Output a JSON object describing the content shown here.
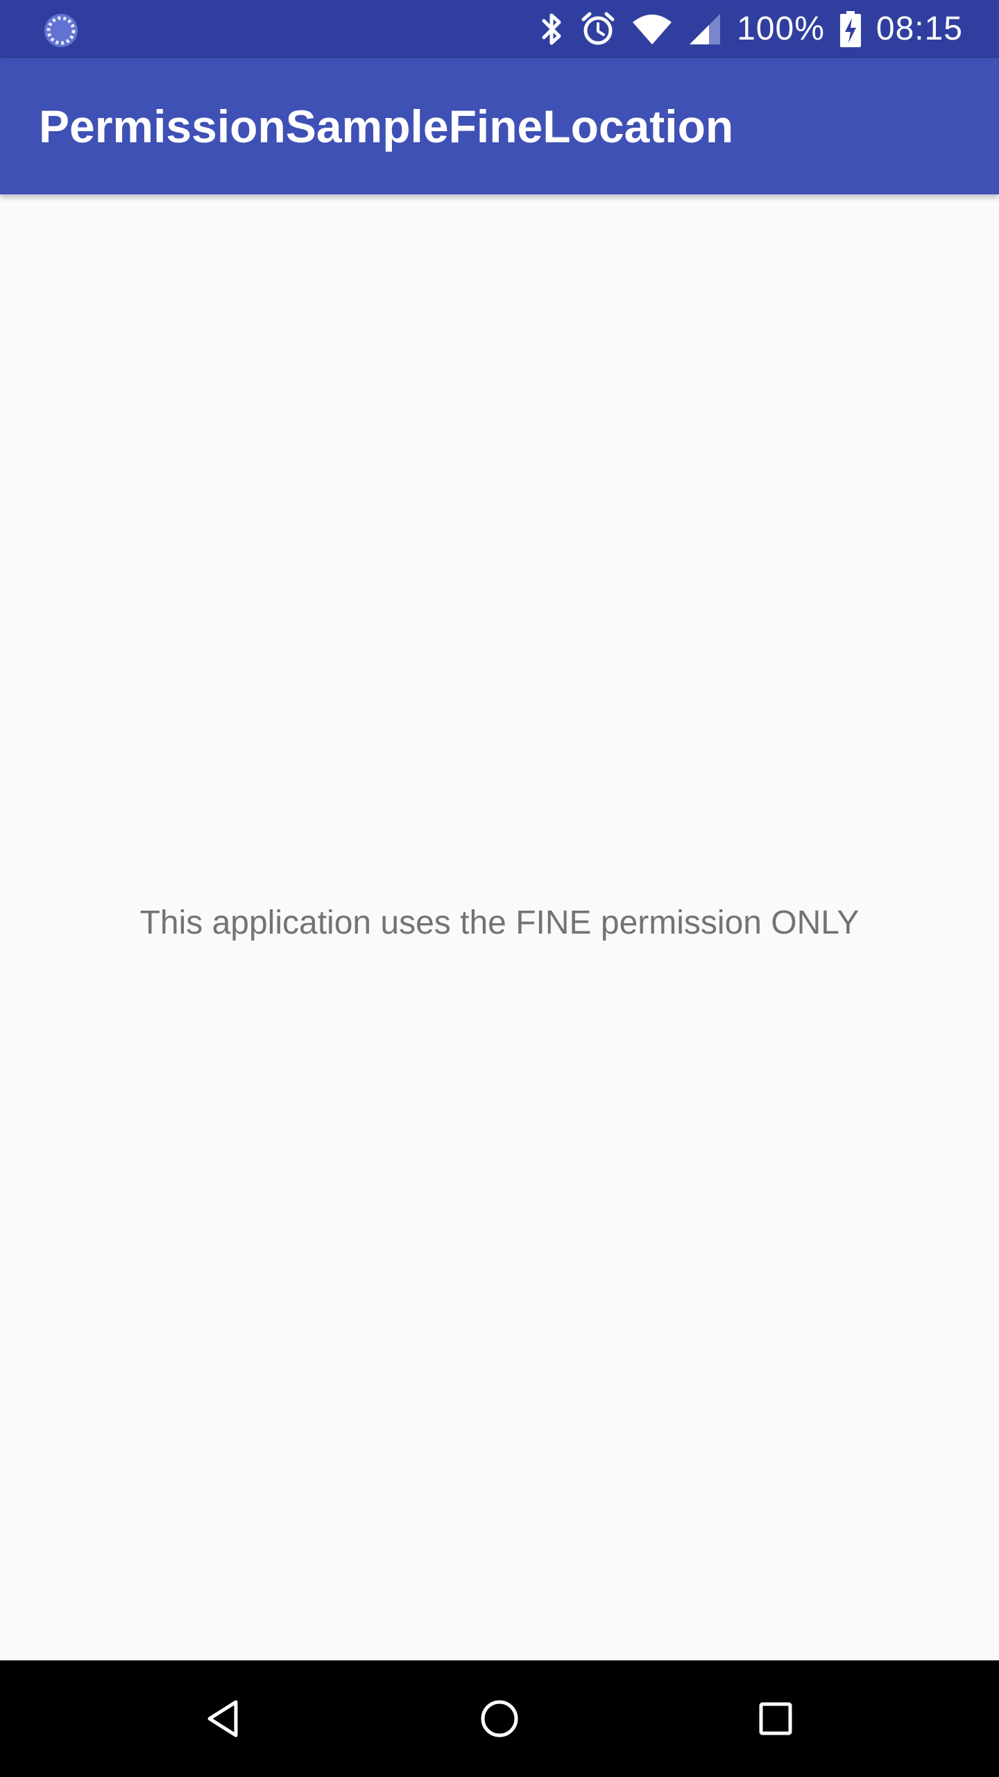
{
  "status_bar": {
    "battery_percent": "100%",
    "time": "08:15",
    "icons": [
      "loading-indicator-icon",
      "bluetooth-icon",
      "alarm-icon",
      "wifi-icon",
      "cell-signal-icon",
      "battery-charging-icon"
    ]
  },
  "app_bar": {
    "title": "PermissionSampleFineLocation"
  },
  "main": {
    "message": "This application uses the FINE permission ONLY"
  },
  "nav_bar": {
    "icons": [
      "back-icon",
      "home-icon",
      "recents-icon"
    ]
  },
  "colors": {
    "status_bar": "#303f9f",
    "app_bar": "#3f51b5",
    "background": "#fafafa",
    "message_text": "#737373",
    "nav_bar": "#000000"
  }
}
